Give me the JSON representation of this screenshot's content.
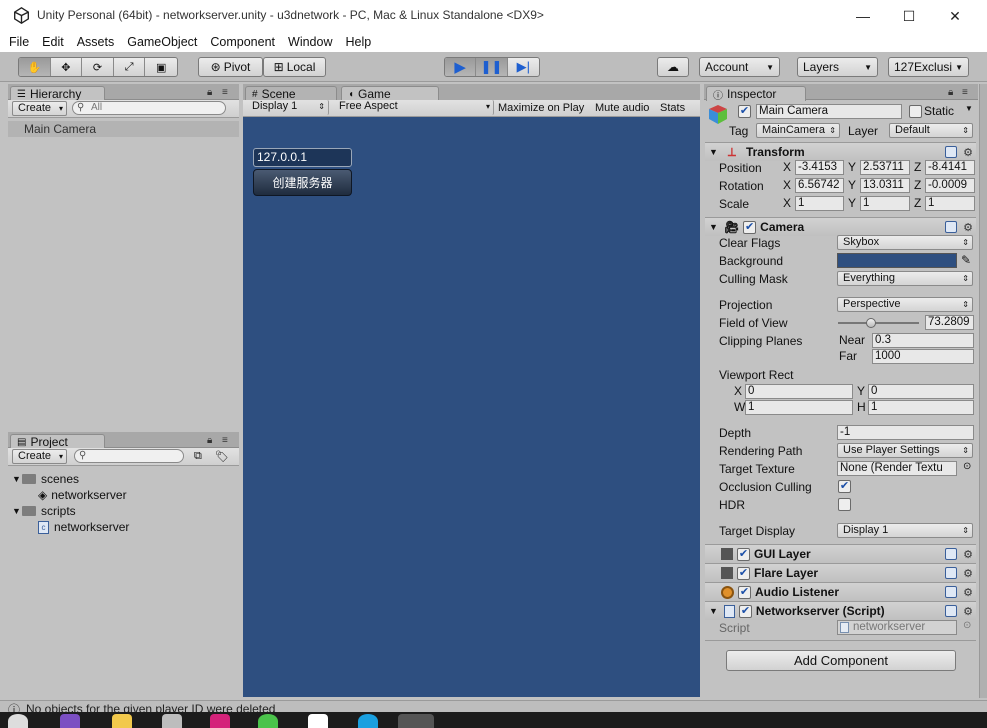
{
  "window": {
    "title": "Unity Personal (64bit) - networkserver.unity - u3dnetwork - PC, Mac & Linux Standalone <DX9>",
    "minimize": "—",
    "maximize": "☐",
    "close": "✕"
  },
  "menu": [
    "File",
    "Edit",
    "Assets",
    "GameObject",
    "Component",
    "Window",
    "Help"
  ],
  "toolbar": {
    "pivot": "Pivot",
    "local": "Local",
    "account": "Account",
    "layers": "Layers",
    "layout": "127Exclusi"
  },
  "hierarchy": {
    "tab": "Hierarchy",
    "create": "Create",
    "search_placeholder": "All",
    "items": [
      "Main Camera"
    ]
  },
  "views": {
    "scene_tab": "Scene",
    "game_tab": "Game",
    "display": "Display 1",
    "aspect": "Free Aspect",
    "maximize_on_play": "Maximize on Play",
    "mute_audio": "Mute audio",
    "stats": "Stats"
  },
  "game": {
    "ip_value": "127.0.0.1",
    "create_server_button": "创建服务器"
  },
  "project": {
    "tab": "Project",
    "create": "Create",
    "tree": [
      {
        "label": "scenes"
      },
      {
        "label": "networkserver"
      },
      {
        "label": "scripts"
      },
      {
        "label": "networkserver"
      }
    ]
  },
  "inspector": {
    "tab": "Inspector",
    "object_name": "Main Camera",
    "static_label": "Static",
    "tag_label": "Tag",
    "tag_value": "MainCamera",
    "layer_label": "Layer",
    "layer_value": "Default",
    "transform": {
      "title": "Transform",
      "position_label": "Position",
      "rotation_label": "Rotation",
      "scale_label": "Scale",
      "position": {
        "x": "-3.4153",
        "y": "2.53711",
        "z": "-8.4141"
      },
      "rotation": {
        "x": "6.56742",
        "y": "13.0311",
        "z": "-0.0009"
      },
      "scale": {
        "x": "1",
        "y": "1",
        "z": "1"
      }
    },
    "camera": {
      "title": "Camera",
      "clear_flags_label": "Clear Flags",
      "clear_flags": "Skybox",
      "background_label": "Background",
      "background_color": "#2e4f80",
      "culling_mask_label": "Culling Mask",
      "culling_mask": "Everything",
      "projection_label": "Projection",
      "projection": "Perspective",
      "fov_label": "Field of View",
      "fov": "73.2809",
      "fov_fraction": 0.41,
      "clipping_label": "Clipping Planes",
      "near_label": "Near",
      "near": "0.3",
      "far_label": "Far",
      "far": "1000",
      "viewport_label": "Viewport Rect",
      "vx": "0",
      "vy": "0",
      "vw": "1",
      "vh": "1",
      "depth_label": "Depth",
      "depth": "-1",
      "rendering_path_label": "Rendering Path",
      "rendering_path": "Use Player Settings",
      "target_texture_label": "Target Texture",
      "target_texture": "None (Render Textu",
      "occlusion_label": "Occlusion Culling",
      "occlusion": true,
      "hdr_label": "HDR",
      "hdr": false,
      "target_display_label": "Target Display",
      "target_display": "Display 1"
    },
    "components": [
      "GUI Layer",
      "Flare Layer",
      "Audio Listener",
      "Networkserver (Script)"
    ],
    "script_label": "Script",
    "script_value": "networkserver",
    "add_component": "Add Component"
  },
  "status": {
    "message": "No objects for the given player ID were deleted"
  }
}
